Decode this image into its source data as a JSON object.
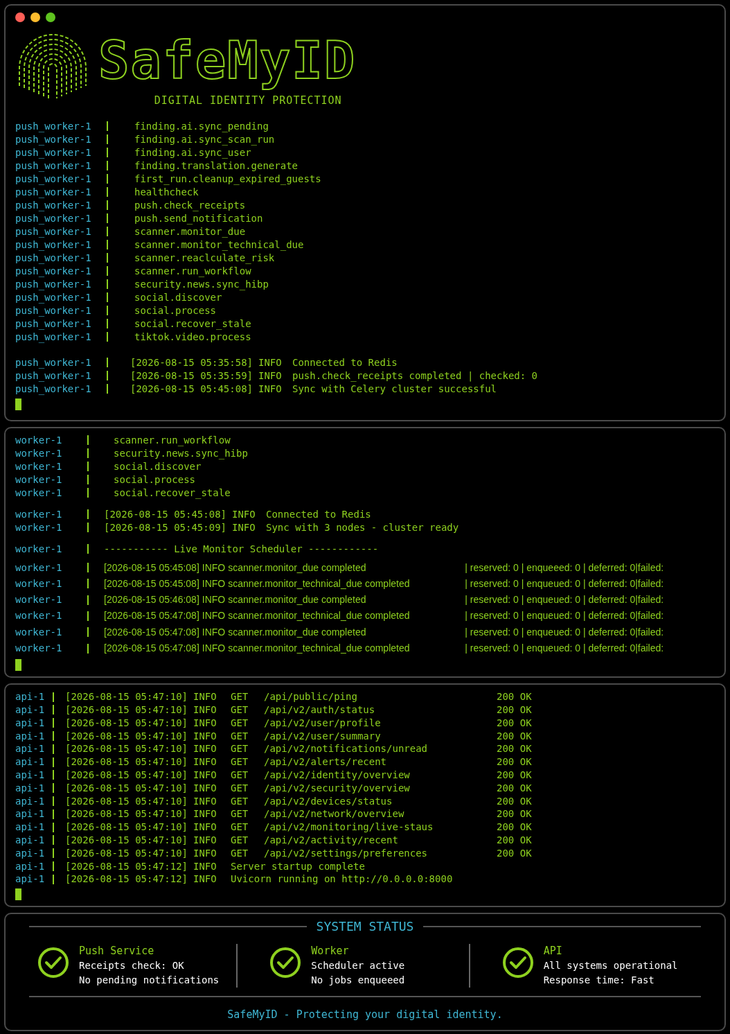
{
  "banner": {
    "logo": "SafeMyID",
    "tagline": "DIGITAL IDENTITY PROTECTION"
  },
  "panes": [
    {
      "groups": [
        {
          "kind": "task",
          "lines": [
            {
              "source": "push_worker-1",
              "text": "finding.ai.sync_pending"
            },
            {
              "source": "push_worker-1",
              "text": "finding.ai.sync_scan_run"
            },
            {
              "source": "push_worker-1",
              "text": "finding.ai.sync_user"
            },
            {
              "source": "push_worker-1",
              "text": "finding.translation.generate"
            },
            {
              "source": "push_worker-1",
              "text": "first_run.cleanup_expired_guests"
            },
            {
              "source": "push_worker-1",
              "text": "healthcheck"
            },
            {
              "source": "push_worker-1",
              "text": "push.check_receipts"
            },
            {
              "source": "push_worker-1",
              "text": "push.send_notification"
            },
            {
              "source": "push_worker-1",
              "text": "scanner.monitor_due"
            },
            {
              "source": "push_worker-1",
              "text": "scanner.monitor_technical_due"
            },
            {
              "source": "push_worker-1",
              "text": "scanner.reaclculate_risk"
            },
            {
              "source": "push_worker-1",
              "text": "scanner.run_workflow"
            },
            {
              "source": "push_worker-1",
              "text": "security.news.sync_hibp"
            },
            {
              "source": "push_worker-1",
              "text": "social.discover"
            },
            {
              "source": "push_worker-1",
              "text": "social.process"
            },
            {
              "source": "push_worker-1",
              "text": "social.recover_stale"
            },
            {
              "source": "push_worker-1",
              "text": "tiktok.video.process"
            }
          ]
        },
        {
          "kind": "log",
          "lines": [
            {
              "source": "push_worker-1",
              "time": "[2026-08-15 05:35:58]",
              "level": "INFO",
              "message": "Connected to Redis"
            },
            {
              "source": "push_worker-1",
              "time": "[2026-08-15 05:35:59]",
              "level": "INFO",
              "message": "push.check_receipts completed | checked: 0"
            },
            {
              "source": "push_worker-1",
              "time": "[2026-08-15 05:45:08]",
              "level": "INFO",
              "message": "Sync with Celery cluster successful"
            }
          ]
        }
      ]
    },
    {
      "groups": [
        {
          "kind": "task",
          "lines": [
            {
              "source": "worker-1",
              "text": "scanner.run_workflow"
            },
            {
              "source": "worker-1",
              "text": "security.news.sync_hibp"
            },
            {
              "source": "worker-1",
              "text": "social.discover"
            },
            {
              "source": "worker-1",
              "text": "social.process"
            },
            {
              "source": "worker-1",
              "text": "social.recover_stale"
            }
          ]
        },
        {
          "kind": "log",
          "lines": [
            {
              "source": "worker-1",
              "time": "[2026-08-15 05:45:08]",
              "level": "INFO",
              "message": "Connected to Redis"
            },
            {
              "source": "worker-1",
              "time": "[2026-08-15 05:45:09]",
              "level": "INFO",
              "message": "Sync with 3 nodes - cluster ready"
            }
          ]
        },
        {
          "kind": "divider",
          "lines": [
            {
              "source": "worker-1",
              "text": "----------- Live Monitor Scheduler ------------"
            }
          ]
        },
        {
          "kind": "sched",
          "lines": [
            {
              "source": "worker-1",
              "time": "[2026-08-15 05:45:08]",
              "level": "INFO",
              "message": "scanner.monitor_due completed",
              "stats": "| reserved: 0 | enqueeed: 0 | deferred: 0|failed:"
            },
            {
              "source": "worker-1",
              "time": "[2026-08-15 05:45:08]",
              "level": "INFO",
              "message": "scanner.monitor_technical_due completed",
              "stats": "| reserved: 0 | enqueued: 0 | deferred: 0|failed:"
            },
            {
              "source": "worker-1",
              "time": "[2026-08-15 05:46:08]",
              "level": "INFO",
              "message": "scanner.monitor_due completed",
              "stats": "| reserved: 0 | enqueued: 0 | deferred: 0|failed:"
            },
            {
              "source": "worker-1",
              "time": "[2026-08-15 05:47:08]",
              "level": "INFO",
              "message": "scanner.monitor_technical_due completed",
              "stats": "| reserved: 0 | enqueued: 0 | deferred: 0|failed:"
            },
            {
              "source": "worker-1",
              "time": "[2026-08-15 05:47:08]",
              "level": "INFO",
              "message": "scanner.monitor_due completed",
              "stats": "| reserved: 0 | enqueued: 0 | deferred: 0|failed:"
            },
            {
              "source": "worker-1",
              "time": "[2026-08-15 05:47:08]",
              "level": "INFO",
              "message": "scanner.monitor_technical_due completed",
              "stats": "| reserved: 0 | enqueued: 0 | deferred: 0|failed:"
            }
          ]
        }
      ]
    },
    {
      "groups": [
        {
          "kind": "request",
          "lines": [
            {
              "source": "api-1",
              "time": "[2026-08-15 05:47:10]",
              "level": "INFO",
              "method": "GET",
              "path": "/api/public/ping",
              "status": "200 OK"
            },
            {
              "source": "api-1",
              "time": "[2026-08-15 05:47:10]",
              "level": "INFO",
              "method": "GET",
              "path": "/api/v2/auth/status",
              "status": "200 OK"
            },
            {
              "source": "api-1",
              "time": "[2026-08-15 05:47:10]",
              "level": "INFO",
              "method": "GET",
              "path": "/api/v2/user/profile",
              "status": "200 OK"
            },
            {
              "source": "api-1",
              "time": "[2026-08-15 05:47:10]",
              "level": "INFO",
              "method": "GET",
              "path": "/api/v2/user/summary",
              "status": "200 OK"
            },
            {
              "source": "api-1",
              "time": "[2026-08-15 05:47:10]",
              "level": "INFO",
              "method": "GET",
              "path": "/api/v2/notifications/unread",
              "status": "200 OK"
            },
            {
              "source": "api-1",
              "time": "[2026-08-15 05:47:10]",
              "level": "INFO",
              "method": "GET",
              "path": "/api/v2/alerts/recent",
              "status": "200 OK"
            },
            {
              "source": "api-1",
              "time": "[2026-08-15 05:47:10]",
              "level": "INFO",
              "method": "GET",
              "path": "/api/v2/identity/overview",
              "status": "200 OK"
            },
            {
              "source": "api-1",
              "time": "[2026-08-15 05:47:10]",
              "level": "INFO",
              "method": "GET",
              "path": "/api/v2/security/overview",
              "status": "200 OK"
            },
            {
              "source": "api-1",
              "time": "[2026-08-15 05:47:10]",
              "level": "INFO",
              "method": "GET",
              "path": "/api/v2/devices/status",
              "status": "200 OK"
            },
            {
              "source": "api-1",
              "time": "[2026-08-15 05:47:10]",
              "level": "INFO",
              "method": "GET",
              "path": "/api/v2/network/overview",
              "status": "200 OK"
            },
            {
              "source": "api-1",
              "time": "[2026-08-15 05:47:10]",
              "level": "INFO",
              "method": "GET",
              "path": "/api/v2/monitoring/live-staus",
              "status": "200 OK"
            },
            {
              "source": "api-1",
              "time": "[2026-08-15 05:47:10]",
              "level": "INFO",
              "method": "GET",
              "path": "/api/v2/activity/recent",
              "status": "200 OK"
            },
            {
              "source": "api-1",
              "time": "[2026-08-15 05:47:10]",
              "level": "INFO",
              "method": "GET",
              "path": "/api/v2/settings/preferences",
              "status": "200 OK"
            },
            {
              "source": "api-1",
              "time": "[2026-08-15 05:47:12]",
              "level": "INFO",
              "message": "Server startup complete"
            },
            {
              "source": "api-1",
              "time": "[2026-08-15 05:47:12]",
              "level": "INFO",
              "message": "Uvicorn running on http://0.0.0.0:8000"
            }
          ]
        }
      ]
    }
  ],
  "system_status": {
    "title": "SYSTEM STATUS",
    "items": [
      {
        "name": "Push Service",
        "ok": true,
        "lines": [
          "Receipts check: OK",
          "No pending notifications"
        ]
      },
      {
        "name": "Worker",
        "ok": true,
        "lines": [
          "Scheduler active",
          "No jobs enqueeed"
        ]
      },
      {
        "name": "API",
        "ok": true,
        "lines": [
          "All systems operational",
          "Response time: Fast"
        ]
      }
    ],
    "footer": "SafeMyID - Protecting your digital identity."
  }
}
